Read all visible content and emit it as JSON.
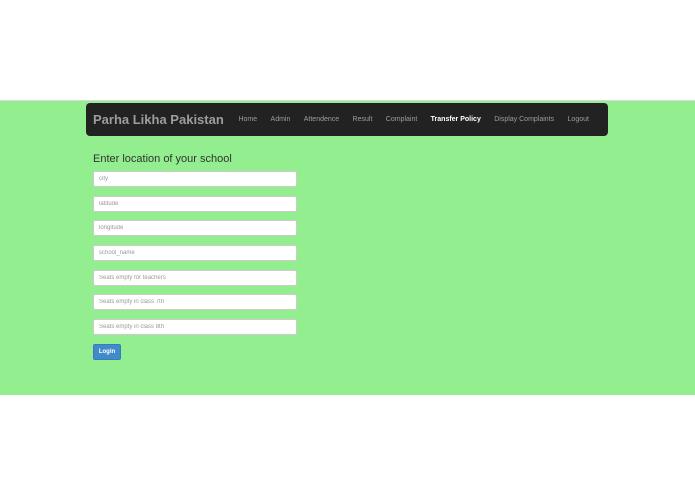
{
  "navbar": {
    "brand": "Parha Likha Pakistan",
    "items": [
      {
        "label": "Home",
        "active": false
      },
      {
        "label": "Admin",
        "active": false
      },
      {
        "label": "Attendence",
        "active": false
      },
      {
        "label": "Result",
        "active": false
      },
      {
        "label": "Complaint",
        "active": false
      },
      {
        "label": "Transfer Policy",
        "active": true
      },
      {
        "label": "Display Complaints",
        "active": false
      },
      {
        "label": "Logout",
        "active": false
      }
    ]
  },
  "form": {
    "title": "Enter location of your school",
    "fields": [
      {
        "placeholder": "city",
        "value": ""
      },
      {
        "placeholder": "latitude",
        "value": ""
      },
      {
        "placeholder": "longitude",
        "value": ""
      },
      {
        "placeholder": "school_name",
        "value": ""
      },
      {
        "placeholder": "Seats empty for teachers",
        "value": ""
      },
      {
        "placeholder": "Seats empty in class 7th",
        "value": ""
      },
      {
        "placeholder": "Seats empty in class 8th",
        "value": ""
      }
    ],
    "submit_label": "Login"
  },
  "colors": {
    "band_background": "#93ee90",
    "navbar_background": "#222222",
    "button_primary": "#428bca"
  }
}
